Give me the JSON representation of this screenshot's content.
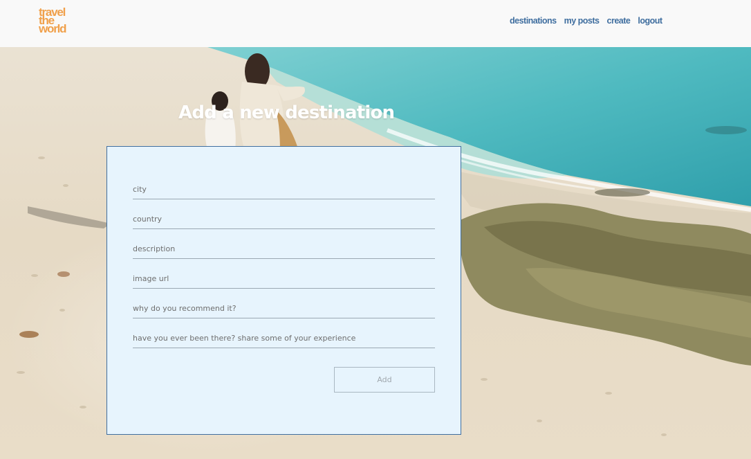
{
  "logo": {
    "lines": [
      "travel",
      "the",
      "world"
    ],
    "color": "#f0a04b"
  },
  "nav": {
    "items": [
      {
        "label": "destinations"
      },
      {
        "label": "my posts"
      },
      {
        "label": "create"
      },
      {
        "label": "logout"
      }
    ],
    "color": "#3f6e9f"
  },
  "form": {
    "title": "Add a new destination",
    "fields": [
      {
        "value": "",
        "placeholder": "city"
      },
      {
        "value": "",
        "placeholder": "country"
      },
      {
        "value": "",
        "placeholder": "description"
      },
      {
        "value": "",
        "placeholder": "image url"
      },
      {
        "value": "",
        "placeholder": "why do you recommend it?"
      },
      {
        "value": "",
        "placeholder": "have you ever been there? share some of your experience"
      }
    ],
    "submit_label": "Add",
    "card_background": "#e7f4fd",
    "card_border": "#3f6e9f"
  }
}
